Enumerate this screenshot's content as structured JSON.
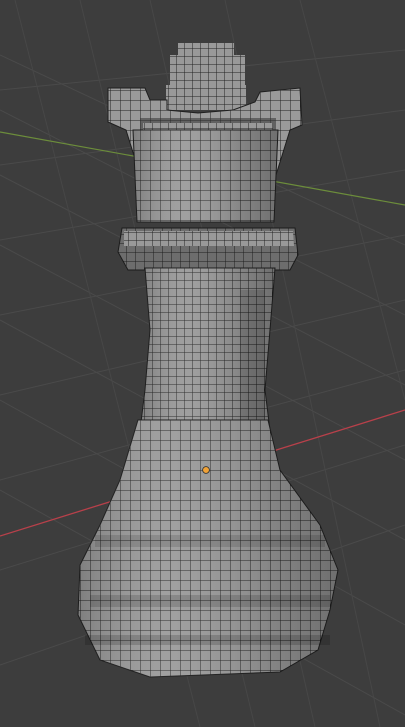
{
  "viewport": {
    "background": "#3d3d3d",
    "grid_color": "#4a4a4a",
    "axis_x_color": "#b8404a",
    "axis_y_color": "#6c8d3b",
    "mesh_fill": "#9a9a9a",
    "mesh_dark": "#6d6d6d",
    "mesh_edge": "#202020",
    "origin_color": "#f0a238"
  },
  "scene": {
    "object_icon": "voxel-rook-mesh",
    "origin_icon": "object-origin-dot"
  }
}
